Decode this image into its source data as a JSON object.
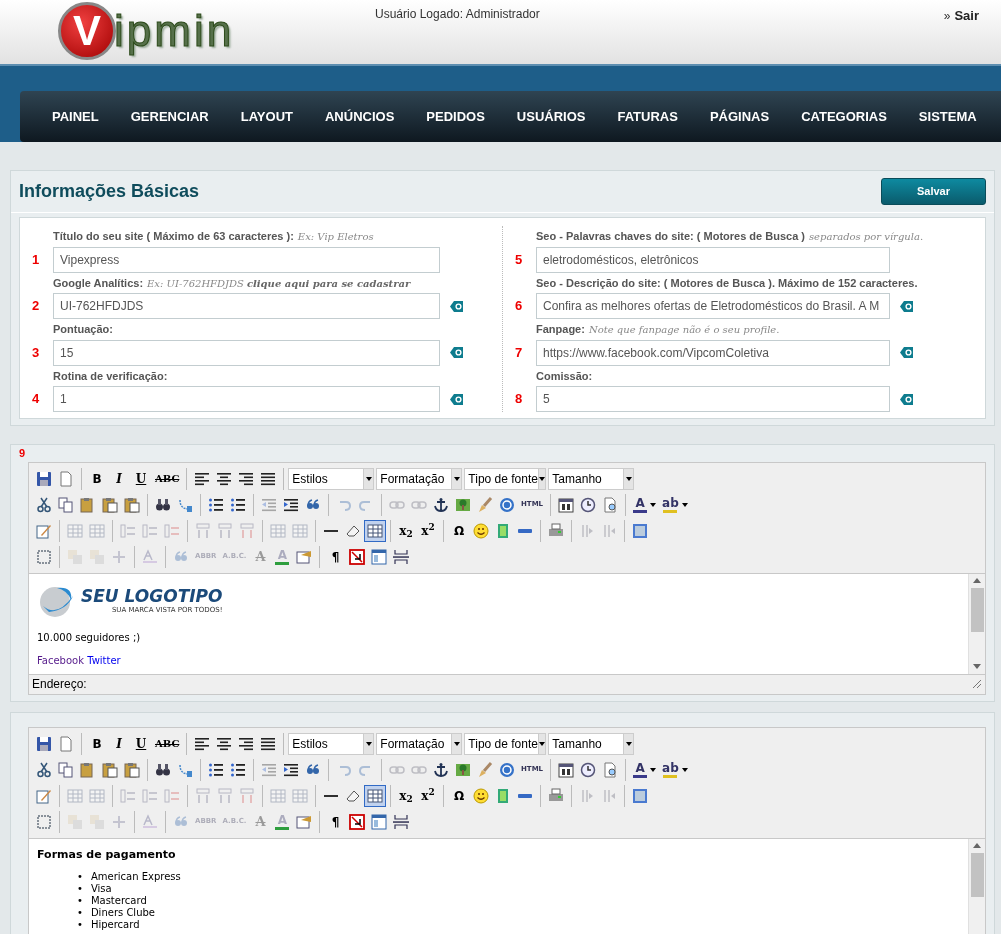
{
  "header": {
    "logo": {
      "mark": "V",
      "text": "ipmin"
    },
    "user_label": "Usuário Logado: Administrador",
    "logout": {
      "arrow": "»",
      "label": "Sair"
    }
  },
  "nav": [
    "PAINEL",
    "GERENCIAR",
    "LAYOUT",
    "ANÚNCIOS",
    "PEDIDOS",
    "USUÁRIOS",
    "FATURAS",
    "PÁGINAS",
    "CATEGORIAS",
    "SISTEMA"
  ],
  "basic_info": {
    "title": "Informações Básicas",
    "save_button": "Salvar",
    "columns": [
      [
        {
          "number": "1",
          "label": "Título do seu site ( Máximo de 63 caracteres ):",
          "hint": "Ex: Vip Eletros",
          "value": "Vipexpress",
          "help": false
        },
        {
          "number": "2",
          "label": "Google Analítics:",
          "hint": "Ex: UI-762HFDJDS",
          "link": "clique aqui para se cadastrar",
          "value": "UI-762HFDJDS",
          "help": true
        },
        {
          "number": "3",
          "label": "Pontuação:",
          "value": "15",
          "help": true
        },
        {
          "number": "4",
          "label": "Rotina de verificação:",
          "value": "1",
          "help": true
        }
      ],
      [
        {
          "number": "5",
          "label": "Seo - Palavras chaves do site: ( Motores de Busca )",
          "hint": "separados por vírgula.",
          "value": "eletrodomésticos, eletrônicos",
          "help": false
        },
        {
          "number": "6",
          "label": "Seo - Descrição do site: ( Motores de Busca ). Máximo de 152 caracteres.",
          "value": "Confira as melhores ofertas de Eletrodomésticos do Brasil. A M",
          "help": true
        },
        {
          "number": "7",
          "label": "Fanpage:",
          "hint": "Note que fanpage não é o seu profile.",
          "value": "https://www.facebook.com/VipcomColetiva",
          "help": true
        },
        {
          "number": "8",
          "label": "Comissão:",
          "value": "5",
          "help": true
        }
      ]
    ]
  },
  "editors": [
    {
      "number": "9",
      "status_label": "Endereço:",
      "toolbar": [
        [
          [
            {
              "kind": "icon",
              "disabled": false,
              "pressed": false
            },
            {
              "kind": "icon",
              "disabled": false,
              "pressed": false
            }
          ],
          [
            {
              "kind": "text",
              "label": "B",
              "disabled": false,
              "pressed": false
            },
            {
              "kind": "italic",
              "label": "I",
              "disabled": false,
              "pressed": false
            },
            {
              "kind": "underline",
              "label": "U",
              "disabled": false,
              "pressed": false
            },
            {
              "kind": "strike",
              "label": "ABC",
              "disabled": false,
              "pressed": false
            }
          ],
          [
            {
              "kind": "icon",
              "disabled": false,
              "pressed": false
            },
            {
              "kind": "icon",
              "disabled": false,
              "pressed": false
            },
            {
              "kind": "icon",
              "disabled": false,
              "pressed": false
            },
            {
              "kind": "icon",
              "disabled": false,
              "pressed": false
            }
          ],
          [
            {
              "kind": "select",
              "label": "Estilos"
            },
            {
              "kind": "select",
              "label": "Formatação"
            },
            {
              "kind": "select",
              "label": "Tipo de fonte"
            },
            {
              "kind": "select",
              "label": "Tamanho"
            }
          ]
        ],
        [
          [
            {
              "kind": "icon",
              "disabled": false,
              "pressed": false
            },
            {
              "kind": "icon",
              "disabled": false,
              "pressed": false
            },
            {
              "kind": "icon",
              "disabled": false,
              "pressed": false
            },
            {
              "kind": "icon",
              "disabled": false,
              "pressed": false
            },
            {
              "kind": "icon",
              "disabled": false,
              "pressed": false
            }
          ],
          [
            {
              "kind": "icon",
              "disabled": false,
              "pressed": false
            },
            {
              "kind": "icon",
              "disabled": false,
              "pressed": false
            }
          ],
          [
            {
              "kind": "icon",
              "disabled": false,
              "pressed": false
            },
            {
              "kind": "icon",
              "disabled": false,
              "pressed": false
            }
          ],
          [
            {
              "kind": "icon",
              "disabled": true,
              "pressed": false
            },
            {
              "kind": "icon",
              "disabled": false,
              "pressed": false
            },
            {
              "kind": "icon",
              "disabled": false,
              "pressed": false
            }
          ],
          [
            {
              "kind": "icon",
              "disabled": true,
              "pressed": false
            },
            {
              "kind": "icon",
              "disabled": true,
              "pressed": false
            }
          ],
          [
            {
              "kind": "icon",
              "disabled": true,
              "pressed": false
            },
            {
              "kind": "icon",
              "disabled": true,
              "pressed": false
            },
            {
              "kind": "icon",
              "disabled": false,
              "pressed": false
            },
            {
              "kind": "icon",
              "disabled": false,
              "pressed": false
            },
            {
              "kind": "icon",
              "disabled": false,
              "pressed": false
            },
            {
              "kind": "icon",
              "disabled": false,
              "pressed": false
            },
            {
              "kind": "small",
              "label": "HTML",
              "disabled": false,
              "pressed": false
            }
          ],
          [
            {
              "kind": "icon",
              "disabled": false,
              "pressed": false
            },
            {
              "kind": "icon",
              "disabled": false,
              "pressed": false
            },
            {
              "kind": "icon",
              "disabled": false,
              "pressed": false
            }
          ],
          [
            {
              "kind": "color",
              "label": "A",
              "color": "#3a3a8a",
              "caret": true,
              "disabled": false,
              "pressed": false
            },
            {
              "kind": "color",
              "label": "ab",
              "color": "#e0c020",
              "caret": true,
              "disabled": false,
              "pressed": false
            }
          ]
        ],
        [
          [
            {
              "kind": "icon",
              "disabled": false,
              "pressed": false
            }
          ],
          [
            {
              "kind": "icon",
              "disabled": true,
              "pressed": false
            },
            {
              "kind": "icon",
              "disabled": true,
              "pressed": false
            }
          ],
          [
            {
              "kind": "icon",
              "disabled": true,
              "pressed": false
            },
            {
              "kind": "icon",
              "disabled": true,
              "pressed": false
            },
            {
              "kind": "icon",
              "disabled": true,
              "pressed": false
            }
          ],
          [
            {
              "kind": "icon",
              "disabled": true,
              "pressed": false
            },
            {
              "kind": "icon",
              "disabled": true,
              "pressed": false
            },
            {
              "kind": "icon",
              "disabled": true,
              "pressed": false
            }
          ],
          [
            {
              "kind": "icon",
              "disabled": true,
              "pressed": false
            },
            {
              "kind": "icon",
              "disabled": true,
              "pressed": false
            }
          ],
          [
            {
              "kind": "icon",
              "disabled": false,
              "pressed": false
            },
            {
              "kind": "icon",
              "disabled": false,
              "pressed": false
            },
            {
              "kind": "icon",
              "disabled": false,
              "pressed": true
            }
          ],
          [
            {
              "kind": "text",
              "label": "x$_{2}$",
              "disabled": false,
              "pressed": false
            },
            {
              "kind": "text",
              "label": "x$^{2}$",
              "disabled": false,
              "pressed": false
            }
          ],
          [
            {
              "kind": "text",
              "label": "Ω",
              "disabled": false,
              "pressed": false
            },
            {
              "kind": "icon",
              "disabled": false,
              "pressed": false
            },
            {
              "kind": "icon",
              "disabled": false,
              "pressed": false
            },
            {
              "kind": "icon",
              "disabled": false,
              "pressed": false
            }
          ],
          [
            {
              "kind": "icon",
              "disabled": false,
              "pressed": false
            }
          ],
          [
            {
              "kind": "icon",
              "disabled": true,
              "pressed": false
            },
            {
              "kind": "icon",
              "disabled": true,
              "pressed": false
            }
          ],
          [
            {
              "kind": "icon",
              "disabled": false,
              "pressed": false
            }
          ]
        ],
        [
          [
            {
              "kind": "icon",
              "disabled": false,
              "pressed": false
            }
          ],
          [
            {
              "kind": "icon",
              "disabled": true,
              "pressed": false
            },
            {
              "kind": "icon",
              "disabled": true,
              "pressed": false
            },
            {
              "kind": "icon",
              "disabled": true,
              "pressed": false
            }
          ],
          [
            {
              "kind": "icon",
              "disabled": true,
              "pressed": false
            }
          ],
          [
            {
              "kind": "icon",
              "disabled": true,
              "pressed": false
            },
            {
              "kind": "small",
              "label": "ABBR",
              "disabled": true,
              "pressed": false
            },
            {
              "kind": "small",
              "label": "A.B.C.",
              "disabled": true,
              "pressed": false
            },
            {
              "kind": "strike",
              "label": "A",
              "disabled": true,
              "pressed": false
            },
            {
              "kind": "color",
              "label": "A",
              "color": "#2e9e3e",
              "caret": false,
              "disabled": true,
              "pressed": false
            },
            {
              "kind": "icon",
              "disabled": false,
              "pressed": false
            }
          ],
          [
            {
              "kind": "text",
              "label": "¶",
              "disabled": false,
              "pressed": false
            },
            {
              "kind": "icon",
              "disabled": false,
              "pressed": false
            },
            {
              "kind": "icon",
              "disabled": false,
              "pressed": false
            },
            {
              "kind": "icon",
              "disabled": false,
              "pressed": false
            }
          ]
        ]
      ],
      "content": [
        {
          "kind": "logo",
          "title": "SEU LOGOTIPO",
          "tagline": "SUA MARCA VISTA POR TODOS!"
        },
        {
          "kind": "paragraph",
          "text": "10.000 seguidores ;)"
        },
        {
          "kind": "links",
          "links": [
            {
              "label": "Facebook",
              "visited": true
            },
            {
              "label": "Twitter",
              "visited": false
            }
          ]
        }
      ]
    },
    {
      "toolbar": [
        [
          [
            {
              "kind": "icon",
              "disabled": false,
              "pressed": false
            },
            {
              "kind": "icon",
              "disabled": false,
              "pressed": false
            }
          ],
          [
            {
              "kind": "text",
              "label": "B",
              "disabled": false,
              "pressed": false
            },
            {
              "kind": "italic",
              "label": "I",
              "disabled": false,
              "pressed": false
            },
            {
              "kind": "underline",
              "label": "U",
              "disabled": false,
              "pressed": false
            },
            {
              "kind": "strike",
              "label": "ABC",
              "disabled": false,
              "pressed": false
            }
          ],
          [
            {
              "kind": "icon",
              "disabled": false,
              "pressed": false
            },
            {
              "kind": "icon",
              "disabled": false,
              "pressed": false
            },
            {
              "kind": "icon",
              "disabled": false,
              "pressed": false
            },
            {
              "kind": "icon",
              "disabled": false,
              "pressed": false
            }
          ],
          [
            {
              "kind": "select",
              "label": "Estilos"
            },
            {
              "kind": "select",
              "label": "Formatação"
            },
            {
              "kind": "select",
              "label": "Tipo de fonte"
            },
            {
              "kind": "select",
              "label": "Tamanho"
            }
          ]
        ],
        [
          [
            {
              "kind": "icon",
              "disabled": false,
              "pressed": false
            },
            {
              "kind": "icon",
              "disabled": false,
              "pressed": false
            },
            {
              "kind": "icon",
              "disabled": false,
              "pressed": false
            },
            {
              "kind": "icon",
              "disabled": false,
              "pressed": false
            },
            {
              "kind": "icon",
              "disabled": false,
              "pressed": false
            }
          ],
          [
            {
              "kind": "icon",
              "disabled": false,
              "pressed": false
            },
            {
              "kind": "icon",
              "disabled": false,
              "pressed": false
            }
          ],
          [
            {
              "kind": "icon",
              "disabled": false,
              "pressed": false
            },
            {
              "kind": "icon",
              "disabled": false,
              "pressed": false
            }
          ],
          [
            {
              "kind": "icon",
              "disabled": true,
              "pressed": false
            },
            {
              "kind": "icon",
              "disabled": false,
              "pressed": false
            },
            {
              "kind": "icon",
              "disabled": false,
              "pressed": false
            }
          ],
          [
            {
              "kind": "icon",
              "disabled": true,
              "pressed": false
            },
            {
              "kind": "icon",
              "disabled": true,
              "pressed": false
            }
          ],
          [
            {
              "kind": "icon",
              "disabled": true,
              "pressed": false
            },
            {
              "kind": "icon",
              "disabled": true,
              "pressed": false
            },
            {
              "kind": "icon",
              "disabled": false,
              "pressed": false
            },
            {
              "kind": "icon",
              "disabled": false,
              "pressed": false
            },
            {
              "kind": "icon",
              "disabled": false,
              "pressed": false
            },
            {
              "kind": "icon",
              "disabled": false,
              "pressed": false
            },
            {
              "kind": "small",
              "label": "HTML",
              "disabled": false,
              "pressed": false
            }
          ],
          [
            {
              "kind": "icon",
              "disabled": false,
              "pressed": false
            },
            {
              "kind": "icon",
              "disabled": false,
              "pressed": false
            },
            {
              "kind": "icon",
              "disabled": false,
              "pressed": false
            }
          ],
          [
            {
              "kind": "color",
              "label": "A",
              "color": "#3a3a8a",
              "caret": true,
              "disabled": false,
              "pressed": false
            },
            {
              "kind": "color",
              "label": "ab",
              "color": "#e0c020",
              "caret": true,
              "disabled": false,
              "pressed": false
            }
          ]
        ],
        [
          [
            {
              "kind": "icon",
              "disabled": false,
              "pressed": false
            }
          ],
          [
            {
              "kind": "icon",
              "disabled": true,
              "pressed": false
            },
            {
              "kind": "icon",
              "disabled": true,
              "pressed": false
            }
          ],
          [
            {
              "kind": "icon",
              "disabled": true,
              "pressed": false
            },
            {
              "kind": "icon",
              "disabled": true,
              "pressed": false
            },
            {
              "kind": "icon",
              "disabled": true,
              "pressed": false
            }
          ],
          [
            {
              "kind": "icon",
              "disabled": true,
              "pressed": false
            },
            {
              "kind": "icon",
              "disabled": true,
              "pressed": false
            },
            {
              "kind": "icon",
              "disabled": true,
              "pressed": false
            }
          ],
          [
            {
              "kind": "icon",
              "disabled": true,
              "pressed": false
            },
            {
              "kind": "icon",
              "disabled": true,
              "pressed": false
            }
          ],
          [
            {
              "kind": "icon",
              "disabled": false,
              "pressed": false
            },
            {
              "kind": "icon",
              "disabled": false,
              "pressed": false
            },
            {
              "kind": "icon",
              "disabled": false,
              "pressed": true
            }
          ],
          [
            {
              "kind": "text",
              "label": "x$_{2}$",
              "disabled": false,
              "pressed": false
            },
            {
              "kind": "text",
              "label": "x$^{2}$",
              "disabled": false,
              "pressed": false
            }
          ],
          [
            {
              "kind": "text",
              "label": "Ω",
              "disabled": false,
              "pressed": false
            },
            {
              "kind": "icon",
              "disabled": false,
              "pressed": false
            },
            {
              "kind": "icon",
              "disabled": false,
              "pressed": false
            },
            {
              "kind": "icon",
              "disabled": false,
              "pressed": false
            }
          ],
          [
            {
              "kind": "icon",
              "disabled": false,
              "pressed": false
            }
          ],
          [
            {
              "kind": "icon",
              "disabled": true,
              "pressed": false
            },
            {
              "kind": "icon",
              "disabled": true,
              "pressed": false
            }
          ],
          [
            {
              "kind": "icon",
              "disabled": false,
              "pressed": false
            }
          ]
        ],
        [
          [
            {
              "kind": "icon",
              "disabled": false,
              "pressed": false
            }
          ],
          [
            {
              "kind": "icon",
              "disabled": true,
              "pressed": false
            },
            {
              "kind": "icon",
              "disabled": true,
              "pressed": false
            },
            {
              "kind": "icon",
              "disabled": true,
              "pressed": false
            }
          ],
          [
            {
              "kind": "icon",
              "disabled": true,
              "pressed": false
            }
          ],
          [
            {
              "kind": "icon",
              "disabled": true,
              "pressed": false
            },
            {
              "kind": "small",
              "label": "ABBR",
              "disabled": true,
              "pressed": false
            },
            {
              "kind": "small",
              "label": "A.B.C.",
              "disabled": true,
              "pressed": false
            },
            {
              "kind": "strike",
              "label": "A",
              "disabled": true,
              "pressed": false
            },
            {
              "kind": "color",
              "label": "A",
              "color": "#2e9e3e",
              "caret": false,
              "disabled": true,
              "pressed": false
            },
            {
              "kind": "icon",
              "disabled": false,
              "pressed": false
            }
          ],
          [
            {
              "kind": "text",
              "label": "¶",
              "disabled": false,
              "pressed": false
            },
            {
              "kind": "icon",
              "disabled": false,
              "pressed": false
            },
            {
              "kind": "icon",
              "disabled": false,
              "pressed": false
            },
            {
              "kind": "icon",
              "disabled": false,
              "pressed": false
            }
          ]
        ]
      ],
      "content": [
        {
          "kind": "heading",
          "text": "Formas de pagamento"
        },
        {
          "kind": "list",
          "marker": "•",
          "items": [
            "American Express",
            "Visa",
            "Mastercard",
            "Diners Clube",
            "Hipercard"
          ]
        }
      ]
    }
  ]
}
